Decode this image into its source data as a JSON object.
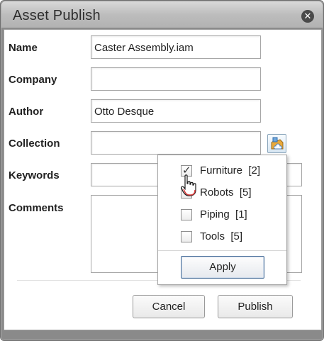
{
  "window": {
    "title": "Asset Publish",
    "close_icon": "close-icon"
  },
  "form": {
    "name": {
      "label": "Name",
      "value": "Caster Assembly.iam"
    },
    "company": {
      "label": "Company",
      "value": ""
    },
    "author": {
      "label": "Author",
      "value": "Otto Desque"
    },
    "collection": {
      "label": "Collection",
      "value": "",
      "button_icon": "collection-picker-icon"
    },
    "keywords": {
      "label": "Keywords",
      "value": ""
    },
    "comments": {
      "label": "Comments",
      "value": ""
    }
  },
  "collection_popup": {
    "items": [
      {
        "label": "Furniture",
        "count": "[2]",
        "checked": true
      },
      {
        "label": "Robots",
        "count": "[5]",
        "checked": false
      },
      {
        "label": "Piping",
        "count": "[1]",
        "checked": false
      },
      {
        "label": "Tools",
        "count": "[5]",
        "checked": false
      }
    ],
    "apply_label": "Apply"
  },
  "buttons": {
    "cancel": "Cancel",
    "publish": "Publish"
  },
  "cursor": {
    "icon": "hand-pointer-cursor"
  }
}
